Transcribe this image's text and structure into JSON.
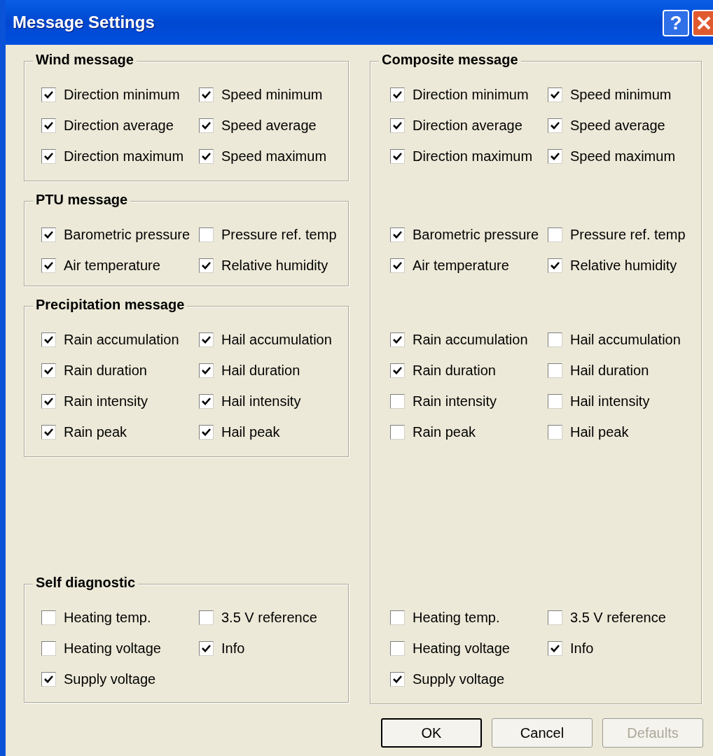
{
  "window": {
    "title": "Message Settings"
  },
  "title_buttons": [
    {
      "kind": "help",
      "label": "?"
    },
    {
      "kind": "close"
    }
  ],
  "groups": [
    {
      "title": "Wind message",
      "rows": [
        [
          {
            "label": "Direction minimum",
            "checked": true
          },
          {
            "label": "Speed minimum",
            "checked": true
          }
        ],
        [
          {
            "label": "Direction average",
            "checked": true
          },
          {
            "label": "Speed average",
            "checked": true
          }
        ],
        [
          {
            "label": "Direction maximum",
            "checked": true
          },
          {
            "label": "Speed maximum",
            "checked": true
          }
        ]
      ]
    },
    {
      "title": "PTU message",
      "rows": [
        [
          {
            "label": "Barometric pressure",
            "checked": true
          },
          {
            "label": "Pressure ref. temp",
            "checked": false
          }
        ],
        [
          {
            "label": "Air temperature",
            "checked": true
          },
          {
            "label": "Relative humidity",
            "checked": true
          }
        ]
      ]
    },
    {
      "title": "Precipitation message",
      "rows": [
        [
          {
            "label": "Rain accumulation",
            "checked": true
          },
          {
            "label": "Hail accumulation",
            "checked": true
          }
        ],
        [
          {
            "label": "Rain duration",
            "checked": true
          },
          {
            "label": "Hail duration",
            "checked": true
          }
        ],
        [
          {
            "label": "Rain intensity",
            "checked": true
          },
          {
            "label": "Hail intensity",
            "checked": true
          }
        ],
        [
          {
            "label": "Rain peak",
            "checked": true
          },
          {
            "label": "Hail peak",
            "checked": true
          }
        ]
      ]
    },
    {
      "title": "Self diagnostic",
      "rows": [
        [
          {
            "label": "Heating temp.",
            "checked": false
          },
          {
            "label": "3.5 V reference",
            "checked": false
          }
        ],
        [
          {
            "label": "Heating voltage",
            "checked": false
          },
          {
            "label": "Info",
            "checked": true
          }
        ],
        [
          {
            "label": "Supply voltage",
            "checked": true
          }
        ]
      ]
    }
  ],
  "composite": {
    "title": "Composite message",
    "sections": [
      [
        [
          {
            "label": "Direction minimum",
            "checked": true
          },
          {
            "label": "Speed minimum",
            "checked": true
          }
        ],
        [
          {
            "label": "Direction average",
            "checked": true
          },
          {
            "label": "Speed average",
            "checked": true
          }
        ],
        [
          {
            "label": "Direction maximum",
            "checked": true
          },
          {
            "label": "Speed maximum",
            "checked": true
          }
        ]
      ],
      [
        [
          {
            "label": "Barometric pressure",
            "checked": true
          },
          {
            "label": "Pressure ref. temp",
            "checked": false
          }
        ],
        [
          {
            "label": "Air temperature",
            "checked": true
          },
          {
            "label": "Relative humidity",
            "checked": true
          }
        ]
      ],
      [
        [
          {
            "label": "Rain accumulation",
            "checked": true
          },
          {
            "label": "Hail accumulation",
            "checked": false
          }
        ],
        [
          {
            "label": "Rain duration",
            "checked": true
          },
          {
            "label": "Hail duration",
            "checked": false
          }
        ],
        [
          {
            "label": "Rain intensity",
            "checked": false
          },
          {
            "label": "Hail intensity",
            "checked": false
          }
        ],
        [
          {
            "label": "Rain peak",
            "checked": false
          },
          {
            "label": "Hail peak",
            "checked": false
          }
        ]
      ],
      [
        [
          {
            "label": "Heating temp.",
            "checked": false
          },
          {
            "label": "3.5 V reference",
            "checked": false
          }
        ],
        [
          {
            "label": "Heating voltage",
            "checked": false
          },
          {
            "label": "Info",
            "checked": true
          }
        ],
        [
          {
            "label": "Supply voltage",
            "checked": true
          }
        ]
      ]
    ]
  },
  "buttons": [
    {
      "label": "OK",
      "default": true,
      "disabled": false
    },
    {
      "label": "Cancel",
      "default": false,
      "disabled": false
    },
    {
      "label": "Defaults",
      "default": false,
      "disabled": true
    }
  ]
}
